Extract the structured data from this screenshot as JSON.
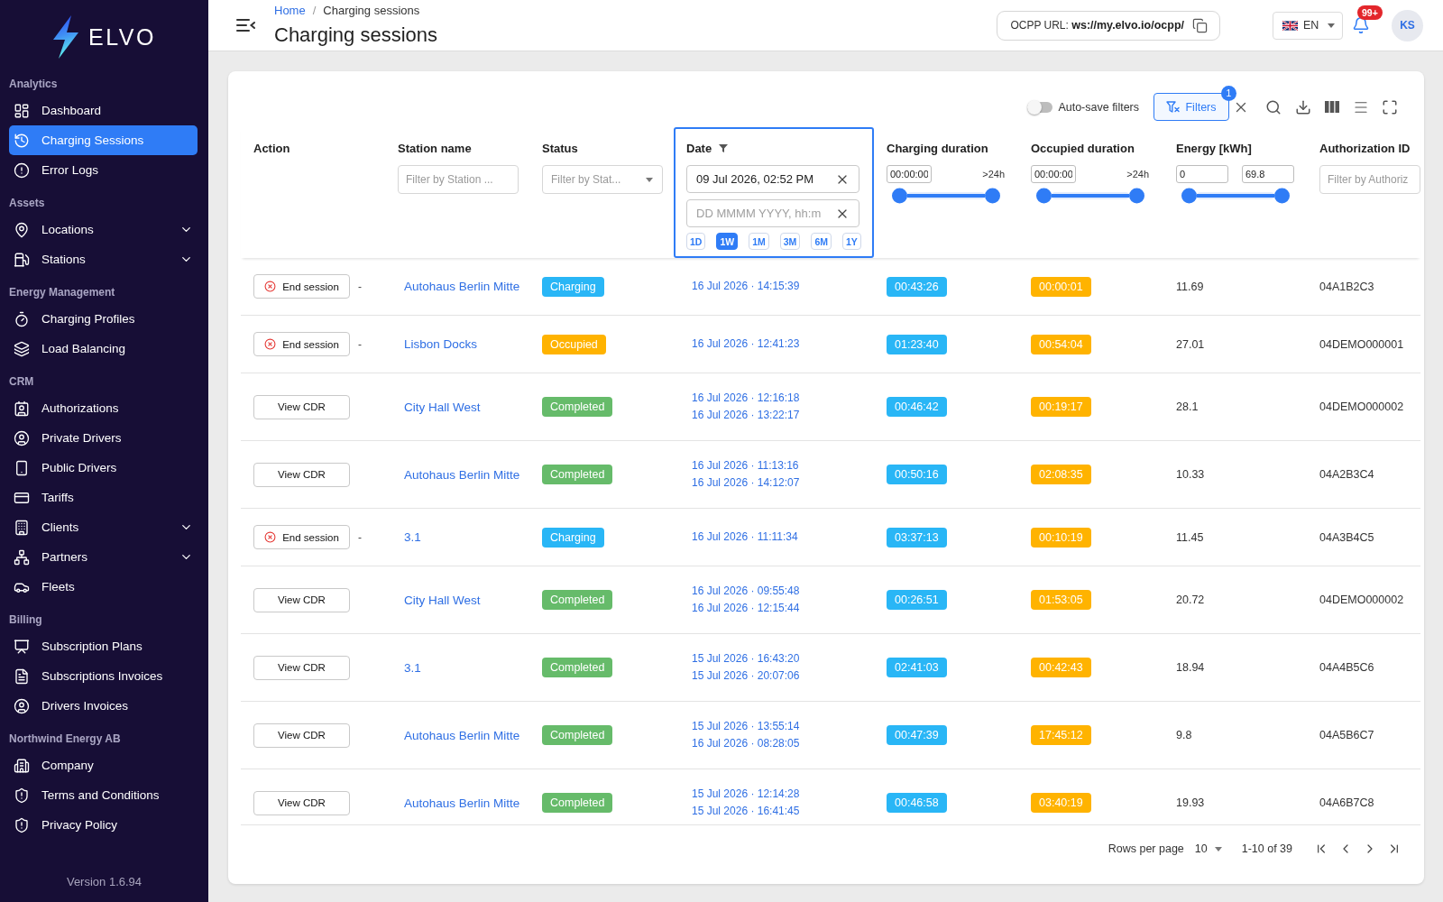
{
  "sidebar": {
    "logo": "ELVO",
    "sections": [
      {
        "title": "Analytics",
        "items": [
          {
            "label": "Dashboard",
            "selected": false,
            "expandable": false
          },
          {
            "label": "Charging Sessions",
            "selected": true,
            "expandable": false
          },
          {
            "label": "Error Logs",
            "selected": false,
            "expandable": false
          }
        ]
      },
      {
        "title": "Assets",
        "items": [
          {
            "label": "Locations",
            "selected": false,
            "expandable": true
          },
          {
            "label": "Stations",
            "selected": false,
            "expandable": true
          }
        ]
      },
      {
        "title": "Energy Management",
        "items": [
          {
            "label": "Charging Profiles",
            "selected": false,
            "expandable": false
          },
          {
            "label": "Load Balancing",
            "selected": false,
            "expandable": false
          }
        ]
      },
      {
        "title": "CRM",
        "items": [
          {
            "label": "Authorizations",
            "selected": false,
            "expandable": false
          },
          {
            "label": "Private Drivers",
            "selected": false,
            "expandable": false
          },
          {
            "label": "Public Drivers",
            "selected": false,
            "expandable": false
          },
          {
            "label": "Tariffs",
            "selected": false,
            "expandable": false
          },
          {
            "label": "Clients",
            "selected": false,
            "expandable": true
          },
          {
            "label": "Partners",
            "selected": false,
            "expandable": true
          },
          {
            "label": "Fleets",
            "selected": false,
            "expandable": false
          }
        ]
      },
      {
        "title": "Billing",
        "items": [
          {
            "label": "Subscription Plans",
            "selected": false,
            "expandable": false
          },
          {
            "label": "Subscriptions Invoices",
            "selected": false,
            "expandable": false
          },
          {
            "label": "Drivers Invoices",
            "selected": false,
            "expandable": false
          }
        ]
      },
      {
        "title": "Northwind Energy AB",
        "items": [
          {
            "label": "Company",
            "selected": false,
            "expandable": false
          },
          {
            "label": "Terms and Conditions",
            "selected": false,
            "expandable": false
          },
          {
            "label": "Privacy Policy",
            "selected": false,
            "expandable": false
          }
        ]
      }
    ],
    "version": "Version 1.6.94"
  },
  "header": {
    "breadcrumb": [
      {
        "label": "Home",
        "current": false
      },
      {
        "label": "Charging sessions",
        "current": true
      }
    ],
    "breadcrumb_separator": "/",
    "title": "Charging sessions",
    "ocpp_url": "OCPP URL: **ws://my.elvo.io/ocpp/**",
    "language": "EN",
    "notifications": "99+",
    "avatar": "KS"
  },
  "toolbar": {
    "auto_save": {
      "label": "Auto-save filters",
      "on": false
    },
    "filters_button": {
      "label": "Filters",
      "badge": "1"
    }
  },
  "table": {
    "columns": [
      {
        "label": "Action",
        "filtered": false,
        "highlighted": false
      },
      {
        "label": "Station name",
        "filtered": false,
        "highlighted": false,
        "filter": {
          "kind": "text",
          "placeholder": "Filter by Station ..."
        }
      },
      {
        "label": "Status",
        "filtered": false,
        "highlighted": false,
        "filter": {
          "kind": "select",
          "placeholder": "Filter by Stat..."
        }
      },
      {
        "label": "Date",
        "filtered": true,
        "highlighted": true,
        "filter": {
          "kind": "date_range",
          "from": {
            "value": "09 Jul 2026, 02:52 PM"
          },
          "to": {
            "placeholder": "DD MMMM YYYY, hh:m"
          },
          "presets": [
            {
              "label": "1D",
              "selected": false
            },
            {
              "label": "1W",
              "selected": true
            },
            {
              "label": "1M",
              "selected": false
            },
            {
              "label": "3M",
              "selected": false
            },
            {
              "label": "6M",
              "selected": false
            },
            {
              "label": "1Y",
              "selected": false
            }
          ]
        }
      },
      {
        "label": "Charging duration",
        "filtered": false,
        "highlighted": false,
        "filter": {
          "kind": "range",
          "inputs": [
            "00:00:00"
          ],
          "max_label": ">24h",
          "level": 1
        }
      },
      {
        "label": "Occupied duration",
        "filtered": false,
        "highlighted": false,
        "filter": {
          "kind": "range",
          "inputs": [
            "00:00:00"
          ],
          "max_label": ">24h",
          "level": 1
        }
      },
      {
        "label": "Energy [kWh]",
        "filtered": false,
        "highlighted": false,
        "filter": {
          "kind": "range",
          "inputs": [
            "0",
            "69.8"
          ],
          "level": 1
        }
      },
      {
        "label": "Authorization ID",
        "filtered": false,
        "highlighted": false,
        "filter": {
          "kind": "text",
          "placeholder": "Filter by Authoriz"
        }
      }
    ],
    "rows": [
      {
        "action": {
          "kind": "end_session",
          "label": "End session",
          "suffix": "-"
        },
        "station": "Autohaus Berlin Mitte",
        "status": {
          "kind": "charging",
          "label": "Charging"
        },
        "dates": [
          "16 Jul 2026 · 14:15:39"
        ],
        "charging_duration": "00:43:26",
        "occupied_duration": "00:00:01",
        "energy": "11.69",
        "authorization_id": "04A1B2C3"
      },
      {
        "action": {
          "kind": "end_session",
          "label": "End session",
          "suffix": "-"
        },
        "station": "Lisbon Docks",
        "status": {
          "kind": "occupied",
          "label": "Occupied"
        },
        "dates": [
          "16 Jul 2026 · 12:41:23"
        ],
        "charging_duration": "01:23:40",
        "occupied_duration": "00:54:04",
        "energy": "27.01",
        "authorization_id": "04DEMO000001"
      },
      {
        "action": {
          "kind": "view_cdr",
          "label": "View CDR"
        },
        "station": "City Hall West",
        "status": {
          "kind": "completed",
          "label": "Completed"
        },
        "dates": [
          "16 Jul 2026 · 12:16:18",
          "16 Jul 2026 · 13:22:17"
        ],
        "charging_duration": "00:46:42",
        "occupied_duration": "00:19:17",
        "energy": "28.1",
        "authorization_id": "04DEMO000002"
      },
      {
        "action": {
          "kind": "view_cdr",
          "label": "View CDR"
        },
        "station": "Autohaus Berlin Mitte",
        "status": {
          "kind": "completed",
          "label": "Completed"
        },
        "dates": [
          "16 Jul 2026 · 11:13:16",
          "16 Jul 2026 · 14:12:07"
        ],
        "charging_duration": "00:50:16",
        "occupied_duration": "02:08:35",
        "energy": "10.33",
        "authorization_id": "04A2B3C4"
      },
      {
        "action": {
          "kind": "end_session",
          "label": "End session",
          "suffix": "-"
        },
        "station": "3.1",
        "status": {
          "kind": "charging",
          "label": "Charging"
        },
        "dates": [
          "16 Jul 2026 · 11:11:34"
        ],
        "charging_duration": "03:37:13",
        "occupied_duration": "00:10:19",
        "energy": "11.45",
        "authorization_id": "04A3B4C5"
      },
      {
        "action": {
          "kind": "view_cdr",
          "label": "View CDR"
        },
        "station": "City Hall West",
        "status": {
          "kind": "completed",
          "label": "Completed"
        },
        "dates": [
          "16 Jul 2026 · 09:55:48",
          "16 Jul 2026 · 12:15:44"
        ],
        "charging_duration": "00:26:51",
        "occupied_duration": "01:53:05",
        "energy": "20.72",
        "authorization_id": "04DEMO000002"
      },
      {
        "action": {
          "kind": "view_cdr",
          "label": "View CDR"
        },
        "station": "3.1",
        "status": {
          "kind": "completed",
          "label": "Completed"
        },
        "dates": [
          "15 Jul 2026 · 16:43:20",
          "15 Jul 2026 · 20:07:06"
        ],
        "charging_duration": "02:41:03",
        "occupied_duration": "00:42:43",
        "energy": "18.94",
        "authorization_id": "04A4B5C6"
      },
      {
        "action": {
          "kind": "view_cdr",
          "label": "View CDR"
        },
        "station": "Autohaus Berlin Mitte",
        "status": {
          "kind": "completed",
          "label": "Completed"
        },
        "dates": [
          "15 Jul 2026 · 13:55:14",
          "16 Jul 2026 · 08:28:05"
        ],
        "charging_duration": "00:47:39",
        "occupied_duration": "17:45:12",
        "energy": "9.8",
        "authorization_id": "04A5B6C7"
      },
      {
        "action": {
          "kind": "view_cdr",
          "label": "View CDR"
        },
        "station": "Autohaus Berlin Mitte",
        "status": {
          "kind": "completed",
          "label": "Completed"
        },
        "dates": [
          "15 Jul 2026 · 12:14:28",
          "15 Jul 2026 · 16:41:45"
        ],
        "charging_duration": "00:46:58",
        "occupied_duration": "03:40:19",
        "energy": "19.93",
        "authorization_id": "04A6B7C8"
      }
    ]
  },
  "pagination": {
    "rows_per_page_label": "Rows per page",
    "rows_per_page": "10",
    "range": "1-10 of 39"
  }
}
